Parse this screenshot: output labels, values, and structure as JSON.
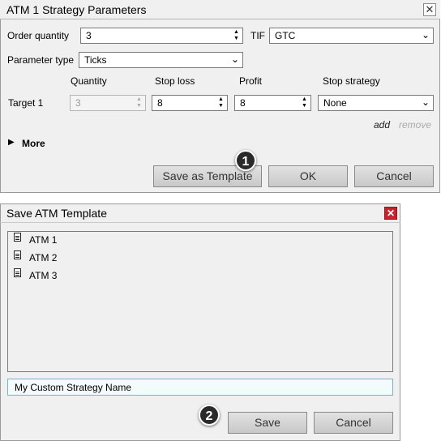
{
  "dialog1": {
    "title": "ATM 1 Strategy Parameters",
    "close_glyph": "✕",
    "order_quantity_label": "Order quantity",
    "order_quantity_value": "3",
    "tif_label": "TIF",
    "tif_value": "GTC",
    "parameter_type_label": "Parameter type",
    "parameter_type_value": "Ticks",
    "columns": [
      "Quantity",
      "Stop loss",
      "Profit",
      "Stop strategy"
    ],
    "target_label": "Target 1",
    "target_quantity": "3",
    "target_stop_loss": "8",
    "target_profit": "8",
    "target_stop_strategy": "None",
    "add_label": "add",
    "remove_label": "remove",
    "more_label": "More",
    "save_template_label": "Save as Template",
    "ok_label": "OK",
    "cancel_label": "Cancel",
    "badge": "1"
  },
  "dialog2": {
    "title": "Save ATM Template",
    "close_glyph": "✕",
    "templates": [
      "ATM 1",
      "ATM 2",
      "ATM 3"
    ],
    "name_value": "My Custom Strategy Name",
    "save_label": "Save",
    "cancel_label": "Cancel",
    "badge": "2"
  },
  "colors": {
    "close_red": "#c8232c",
    "input_focus_border": "#7ab3c4"
  },
  "icons": [
    "close-icon",
    "spinner-arrows-icon",
    "chevron-down-icon",
    "expand-triangle-icon",
    "document-icon"
  ]
}
